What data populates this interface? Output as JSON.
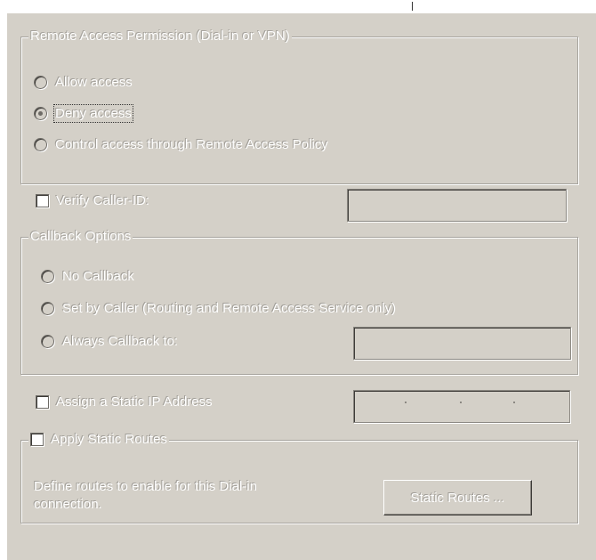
{
  "remote_access": {
    "legend": "Remote Access Permission (Dial-in or VPN)",
    "options": [
      {
        "label": "Allow access",
        "checked": false
      },
      {
        "label": "Deny access",
        "checked": true
      },
      {
        "label": "Control access through Remote Access Policy",
        "checked": false
      }
    ]
  },
  "verify_caller": {
    "label": "Verify Caller-ID:",
    "value": ""
  },
  "callback": {
    "legend": "Callback Options",
    "options": [
      {
        "label": "No Callback",
        "checked": false
      },
      {
        "label": "Set by Caller (Routing and Remote Access Service only)",
        "checked": false
      },
      {
        "label": "Always Callback to:",
        "checked": false
      }
    ],
    "number_value": ""
  },
  "static_ip": {
    "label": "Assign a Static IP Address",
    "value": ". . ."
  },
  "static_routes": {
    "label": "Apply Static Routes",
    "description_line1": "Define routes to enable for this Dial-in",
    "description_line2": "connection.",
    "button_label": "Static Routes ..."
  },
  "colors": {
    "dialog_background": "#d4d0c8",
    "disabled_text": "#ffffff",
    "disabled_shadow": "#a19e98"
  }
}
